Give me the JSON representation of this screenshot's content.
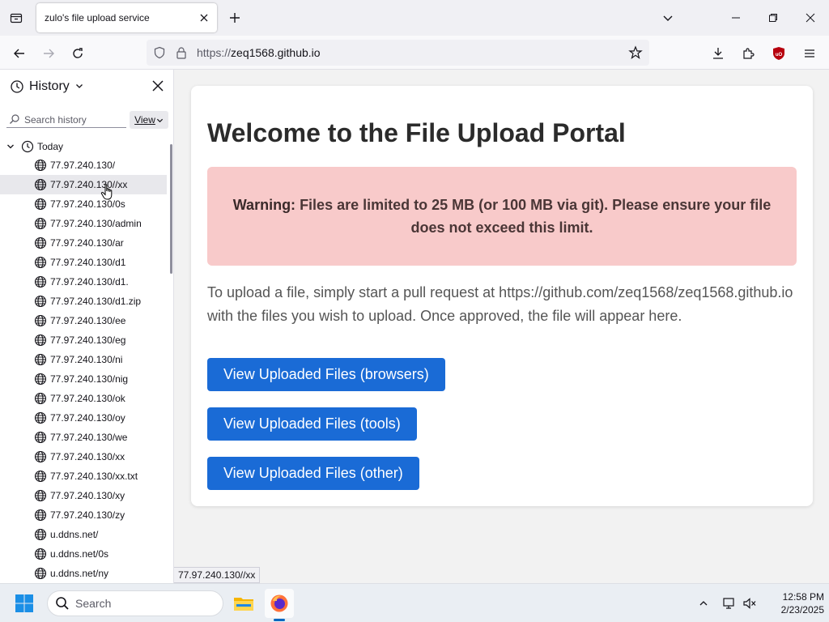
{
  "browser": {
    "tab_title": "zulo's file upload service",
    "url_scheme": "https://",
    "url_host": "zeq1568.github.io"
  },
  "sidebar": {
    "title": "History",
    "search_placeholder": "Search history",
    "view_label": "View",
    "group_label": "Today",
    "items": [
      {
        "label": "77.97.240.130/"
      },
      {
        "label": "77.97.240.130//xx"
      },
      {
        "label": "77.97.240.130/0s"
      },
      {
        "label": "77.97.240.130/admin"
      },
      {
        "label": "77.97.240.130/ar"
      },
      {
        "label": "77.97.240.130/d1"
      },
      {
        "label": "77.97.240.130/d1."
      },
      {
        "label": "77.97.240.130/d1.zip"
      },
      {
        "label": "77.97.240.130/ee"
      },
      {
        "label": "77.97.240.130/eg"
      },
      {
        "label": "77.97.240.130/ni"
      },
      {
        "label": "77.97.240.130/nig"
      },
      {
        "label": "77.97.240.130/ok"
      },
      {
        "label": "77.97.240.130/oy"
      },
      {
        "label": "77.97.240.130/we"
      },
      {
        "label": "77.97.240.130/xx"
      },
      {
        "label": "77.97.240.130/xx.txt"
      },
      {
        "label": "77.97.240.130/xy"
      },
      {
        "label": "77.97.240.130/zy"
      },
      {
        "label": "u.ddns.net/"
      },
      {
        "label": "u.ddns.net/0s"
      },
      {
        "label": "u.ddns.net/ny"
      }
    ]
  },
  "page": {
    "heading": "Welcome to the File Upload Portal",
    "warning_strong": "Warning:",
    "warning_text": " Files are limited to 25 MB (or 100 MB via git). Please ensure your file does not exceed this limit.",
    "intro": "To upload a file, simply start a pull request at https://github.com/zeq1568/zeq1568.github.io with the files you wish to upload. Once approved, the file will appear here.",
    "buttons": [
      {
        "label": "View Uploaded Files (browsers)"
      },
      {
        "label": "View Uploaded Files (tools)"
      },
      {
        "label": "View Uploaded Files (other)"
      }
    ]
  },
  "status_url": "77.97.240.130//xx",
  "taskbar": {
    "search_label": "Search",
    "time": "12:58 PM",
    "date": "2/23/2025"
  },
  "colors": {
    "accent_button": "#1a6bd6",
    "warning_bg": "#f8caca"
  }
}
